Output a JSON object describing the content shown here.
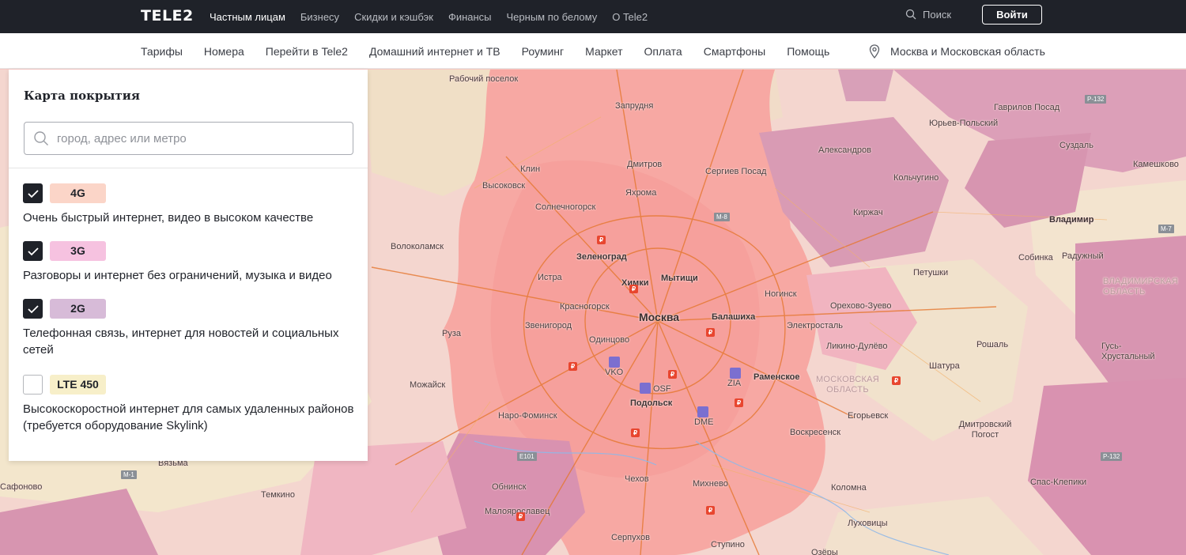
{
  "topbar": {
    "logo": "TELE2",
    "nav": [
      "Частным лицам",
      "Бизнесу",
      "Скидки и кэшбэк",
      "Финансы",
      "Черным по белому",
      "О Tele2"
    ],
    "active_nav": "Частным лицам",
    "search_label": "Поиск",
    "login_label": "Войти"
  },
  "subnav": {
    "items": [
      "Тарифы",
      "Номера",
      "Перейти в Tele2",
      "Домашний интернет и ТВ",
      "Роуминг",
      "Маркет",
      "Оплата",
      "Смартфоны",
      "Помощь"
    ],
    "region": "Москва и Московская область"
  },
  "panel": {
    "title": "Карта покрытия",
    "search_placeholder": "город, адрес или метро",
    "legend": [
      {
        "badge": "4G",
        "color": "#fbd5c8",
        "checked": true,
        "description": "Очень быстрый интернет, видео в высоком качестве"
      },
      {
        "badge": "3G",
        "color": "#f6c2e0",
        "checked": true,
        "description": "Разговоры и интернет без ограничений, музыка и видео"
      },
      {
        "badge": "2G",
        "color": "#d7bbd8",
        "checked": true,
        "description": "Телефонная связь, интернет для новостей и социальных сетей"
      },
      {
        "badge": "LTE 450",
        "color": "#f7efc9",
        "checked": false,
        "description": "Высокоскоростной интернет для самых удаленных районов (требуется оборудование Skylink)"
      }
    ]
  },
  "map": {
    "cities": [
      {
        "name": "Рабочий поселок",
        "size": "small"
      },
      {
        "name": "Запрудня",
        "size": "small"
      },
      {
        "name": "Гаврилов Посад",
        "size": "small"
      },
      {
        "name": "Юрьев-Польский",
        "size": "small"
      },
      {
        "name": "Суздаль",
        "size": "small"
      },
      {
        "name": "Александров",
        "size": "small"
      },
      {
        "name": "Камешково",
        "size": "small"
      },
      {
        "name": "Клин",
        "size": "small"
      },
      {
        "name": "Дмитров",
        "size": "small"
      },
      {
        "name": "Сергиев Посад",
        "size": "small"
      },
      {
        "name": "Кольчугино",
        "size": "small"
      },
      {
        "name": "Высоковск",
        "size": "small"
      },
      {
        "name": "Яхрома",
        "size": "small"
      },
      {
        "name": "Солнечногорск",
        "size": "small"
      },
      {
        "name": "Киржач",
        "size": "small"
      },
      {
        "name": "Владимир",
        "size": "mid"
      },
      {
        "name": "Волоколамск",
        "size": "small"
      },
      {
        "name": "Зеленоград",
        "size": "mid"
      },
      {
        "name": "Собинка",
        "size": "small"
      },
      {
        "name": "Радужный",
        "size": "small"
      },
      {
        "name": "Истра",
        "size": "small"
      },
      {
        "name": "Химки",
        "size": "mid"
      },
      {
        "name": "Мытищи",
        "size": "mid"
      },
      {
        "name": "Петушки",
        "size": "small"
      },
      {
        "name": "Ногинск",
        "size": "small"
      },
      {
        "name": "Красногорск",
        "size": "small"
      },
      {
        "name": "Орехово-Зуево",
        "size": "small"
      },
      {
        "name": "Москва",
        "size": "big"
      },
      {
        "name": "Балашиха",
        "size": "mid"
      },
      {
        "name": "Звенигород",
        "size": "small"
      },
      {
        "name": "Электросталь",
        "size": "small"
      },
      {
        "name": "Руза",
        "size": "small"
      },
      {
        "name": "Одинцово",
        "size": "small"
      },
      {
        "name": "Ликино-Дулёво",
        "size": "small"
      },
      {
        "name": "Рошаль",
        "size": "small"
      },
      {
        "name": "Гусь-Хрустальный",
        "size": "small"
      },
      {
        "name": "Шатура",
        "size": "small"
      },
      {
        "name": "VKO",
        "size": "small"
      },
      {
        "name": "Раменское",
        "size": "mid"
      },
      {
        "name": "ZIA",
        "size": "small"
      },
      {
        "name": "Можайск",
        "size": "small"
      },
      {
        "name": "OSF",
        "size": "small"
      },
      {
        "name": "Подольск",
        "size": "mid"
      },
      {
        "name": "Наро-Фоминск",
        "size": "small"
      },
      {
        "name": "Егорьевск",
        "size": "small"
      },
      {
        "name": "DME",
        "size": "small"
      },
      {
        "name": "Дмитровский Погост",
        "size": "small"
      },
      {
        "name": "Воскресенск",
        "size": "small"
      },
      {
        "name": "Вязьма",
        "size": "small"
      },
      {
        "name": "Обнинск",
        "size": "small"
      },
      {
        "name": "Чехов",
        "size": "small"
      },
      {
        "name": "Михнево",
        "size": "small"
      },
      {
        "name": "Коломна",
        "size": "small"
      },
      {
        "name": "Спас-Клепики",
        "size": "small"
      },
      {
        "name": "Сафоново",
        "size": "small"
      },
      {
        "name": "Темкино",
        "size": "small"
      },
      {
        "name": "Малоярославец",
        "size": "small"
      },
      {
        "name": "Луховицы",
        "size": "small"
      },
      {
        "name": "Серпухов",
        "size": "small"
      },
      {
        "name": "Ступино",
        "size": "small"
      },
      {
        "name": "Озёры",
        "size": "small"
      }
    ],
    "region_labels": [
      "МОСКОВСКАЯ ОБЛАСТЬ",
      "ВЛАДИМИРСКАЯ ОБЛАСТЬ"
    ],
    "highways": [
      "P-132",
      "M-8",
      "M-7",
      "E101",
      "M-1",
      "P-132"
    ]
  }
}
